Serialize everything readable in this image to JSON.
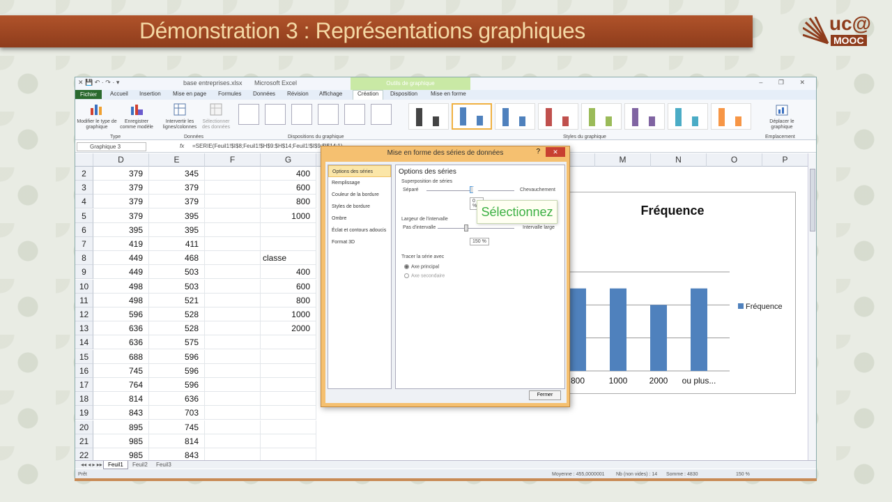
{
  "banner": {
    "title": "Démonstration 3 : Représentations graphiques"
  },
  "logo": {
    "uc": "uc@",
    "mooc": "MOOC"
  },
  "excel": {
    "quick_access": "✕ 💾 ↶ · ↷ · ▾",
    "filename": "base entreprises.xlsx",
    "app_name": "Microsoft Excel",
    "context_tab": "Outils de graphique",
    "window_controls": "‒ ❐ ✕",
    "tabs": [
      "Fichier",
      "Accueil",
      "Insertion",
      "Mise en page",
      "Formules",
      "Données",
      "Révision",
      "Affichage",
      "Création",
      "Disposition",
      "Mise en forme"
    ],
    "active_tab": "Création",
    "ribbon": {
      "change_type": "Modifier le type de graphique",
      "save_template": "Enregistrer comme modèle",
      "group_type": "Type",
      "switch": "Intervertir les lignes/colonnes",
      "select_data": "Sélectionner des données",
      "group_data": "Données",
      "group_layouts": "Dispositions du graphique",
      "group_styles": "Styles du graphique",
      "move_chart": "Déplacer le graphique",
      "group_location": "Emplacement"
    },
    "name_box": "Graphique 3",
    "fx": "fx",
    "formula": "=SERIE(Feuil1!$I$8;Feuil1!$H$9:$H$14;Feuil1!$I$9:$I$14;1)",
    "columns": [
      "D",
      "E",
      "F",
      "G",
      "M",
      "N",
      "O",
      "P"
    ],
    "rows": [
      {
        "n": "2",
        "d": "379",
        "e": "345",
        "g": "400"
      },
      {
        "n": "3",
        "d": "379",
        "e": "379",
        "g": "600"
      },
      {
        "n": "4",
        "d": "379",
        "e": "379",
        "g": "800"
      },
      {
        "n": "5",
        "d": "379",
        "e": "395",
        "g": "1000"
      },
      {
        "n": "6",
        "d": "395",
        "e": "395",
        "g": ""
      },
      {
        "n": "7",
        "d": "419",
        "e": "411",
        "g": ""
      },
      {
        "n": "8",
        "d": "449",
        "e": "468",
        "g": "classe"
      },
      {
        "n": "9",
        "d": "449",
        "e": "503",
        "g": "400"
      },
      {
        "n": "10",
        "d": "498",
        "e": "503",
        "g": "600"
      },
      {
        "n": "11",
        "d": "498",
        "e": "521",
        "g": "800"
      },
      {
        "n": "12",
        "d": "596",
        "e": "528",
        "g": "1000"
      },
      {
        "n": "13",
        "d": "636",
        "e": "528",
        "g": "2000"
      },
      {
        "n": "14",
        "d": "636",
        "e": "575",
        "g": ""
      },
      {
        "n": "15",
        "d": "688",
        "e": "596",
        "g": ""
      },
      {
        "n": "16",
        "d": "745",
        "e": "596",
        "g": ""
      },
      {
        "n": "17",
        "d": "764",
        "e": "596",
        "g": ""
      },
      {
        "n": "18",
        "d": "814",
        "e": "636",
        "g": ""
      },
      {
        "n": "19",
        "d": "843",
        "e": "703",
        "g": ""
      },
      {
        "n": "20",
        "d": "895",
        "e": "745",
        "g": ""
      },
      {
        "n": "21",
        "d": "985",
        "e": "814",
        "g": ""
      },
      {
        "n": "22",
        "d": "985",
        "e": "843",
        "g": ""
      }
    ],
    "sheets": [
      "Feuil1",
      "Feuil2",
      "Feuil3"
    ],
    "status": {
      "ready": "Prêt",
      "average": "Moyenne : 455,0000001",
      "count": "Nb (non vides) : 14",
      "sum": "Somme : 4830",
      "zoom": "150 %"
    }
  },
  "chart_data": {
    "type": "bar",
    "title": "Fréquence",
    "categories": [
      "800",
      "1000",
      "2000",
      "ou plus..."
    ],
    "series": [
      {
        "name": "Fréquence",
        "values": [
          5,
          5,
          4,
          5
        ]
      }
    ],
    "ylim": [
      0,
      6
    ],
    "grid": true,
    "legend": "right",
    "color": "#4f81bd"
  },
  "dialog": {
    "title": "Mise en forme des séries de données",
    "help": "?",
    "close": "✕",
    "nav": [
      "Options des séries",
      "Remplissage",
      "Couleur de la bordure",
      "Styles de bordure",
      "Ombre",
      "Éclat et contours adoucis",
      "Format 3D"
    ],
    "pane_title": "Options des séries",
    "overlap_label": "Superposition de séries",
    "separated": "Séparé",
    "overlap": "Chevauchement",
    "overlap_value": "0 %",
    "gap_label": "Largeur de l'intervalle",
    "no_gap": "Pas d'intervalle",
    "wide_gap": "Intervalle large",
    "gap_value": "150 %",
    "plot_on": "Tracer la série avec",
    "primary_axis": "Axe principal",
    "secondary_axis": "Axe secondaire",
    "close_button": "Fermer"
  },
  "tooltip": {
    "text": "Sélectionnez"
  }
}
